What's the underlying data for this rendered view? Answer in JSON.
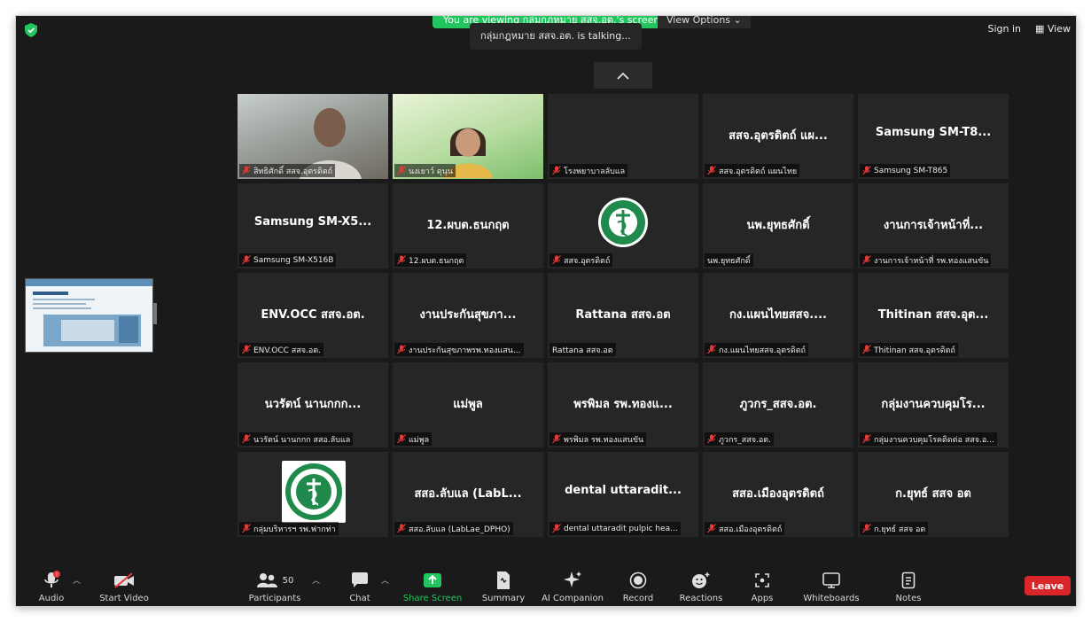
{
  "banner": {
    "viewing_text": "You are viewing กลุ่มกฎหมาย สสจ.อต.'s screen",
    "view_options": "View Options",
    "talking_text": "กลุ่มกฎหมาย สสจ.อต. is talking..."
  },
  "topright": {
    "sign_in": "Sign in",
    "view": "View"
  },
  "tiles": [
    {
      "big": "",
      "label": "สิทธิศักดิ์ สสจ.อุตรดิตถ์",
      "muted": true,
      "kind": "video1"
    },
    {
      "big": "",
      "label": "นงเยาว์ ดุนุน",
      "muted": true,
      "kind": "video2"
    },
    {
      "big": "",
      "label": "โรงพยาบาลลับแล",
      "muted": true,
      "kind": "blank"
    },
    {
      "big": "สสจ.อุตรดิตถ์ แผ...",
      "label": "สสจ.อุตรดิตถ์ แผนไทย",
      "muted": true,
      "kind": "name"
    },
    {
      "big": "Samsung  SM-T8...",
      "label": "Samsung SM-T865",
      "muted": true,
      "kind": "name"
    },
    {
      "big": "Samsung  SM-X5...",
      "label": "Samsung SM-X516B",
      "muted": true,
      "kind": "name"
    },
    {
      "big": "12.ผบต.ธนกฤต",
      "label": "12.ผบต.ธนกฤต",
      "muted": true,
      "kind": "name"
    },
    {
      "big": "",
      "label": "สสจ.อุตรดิตถ์",
      "muted": true,
      "kind": "doh"
    },
    {
      "big": "นพ.ยุทธศักดิ์",
      "label": "นพ.ยุทธศักดิ์",
      "muted": false,
      "kind": "name"
    },
    {
      "big": "งานการเจ้าหน้าที่...",
      "label": "งานการเจ้าหน้าที่ รพ.ทองแสนขัน",
      "muted": true,
      "kind": "name"
    },
    {
      "big": "ENV.OCC สสจ.อต.",
      "label": "ENV.OCC สสจ.อต.",
      "muted": true,
      "kind": "name"
    },
    {
      "big": "งานประกันสุขภา...",
      "label": "งานประกันสุขภาพรพ.ทองแสน...",
      "muted": true,
      "kind": "name"
    },
    {
      "big": "Rattana สสจ.อต",
      "label": "Rattana สสจ.อต",
      "muted": false,
      "kind": "name"
    },
    {
      "big": "กง.แผนไทยสสจ....",
      "label": "กง.แผนไทยสสจ.อุตรดิตถ์",
      "muted": true,
      "kind": "name"
    },
    {
      "big": "Thitinan สสจ.อุต...",
      "label": "Thitinan สสจ.อุตรดิตถ์",
      "muted": true,
      "kind": "name"
    },
    {
      "big": "นวรัตน์ นานกกก...",
      "label": "นวรัตน์ นานกกก สสอ.ลับแล",
      "muted": true,
      "kind": "name"
    },
    {
      "big": "แม่พูล",
      "label": "แม่พูล",
      "muted": true,
      "kind": "name"
    },
    {
      "big": "พรพิมล รพ.ทองแ...",
      "label": "พรพิมล รพ.ทองแสนขัน",
      "muted": true,
      "kind": "name"
    },
    {
      "big": "ภูวกร_สสจ.อต.",
      "label": "ภูวกร_สสจ.อต.",
      "muted": true,
      "kind": "name"
    },
    {
      "big": "กลุ่มงานควบคุมโร...",
      "label": "กลุ่มงานควบคุมโรคติดต่อ สสจ.อ...",
      "muted": true,
      "kind": "name"
    },
    {
      "big": "",
      "label": "กลุ่มบริหารฯ รพ.ฟากท่า",
      "muted": true,
      "kind": "hospital"
    },
    {
      "big": "สสอ.ลับแล (LabL...",
      "label": "สสอ.ลับแล (LabLae_DPHO)",
      "muted": true,
      "kind": "name"
    },
    {
      "big": "dental  uttaradit...",
      "label": "dental  uttaradit pulpic hea...",
      "muted": true,
      "kind": "name"
    },
    {
      "big": "สสอ.เมืองอุตรดิตถ์",
      "label": "สสอ.เมืองอุตรดิตถ์",
      "muted": true,
      "kind": "name"
    },
    {
      "big": "ก.ยุทธ์ สสจ อต",
      "label": "ก.ยุทธ์ สสจ อต",
      "muted": true,
      "kind": "name"
    }
  ],
  "toolbar": {
    "audio": "Audio",
    "start_video": "Start Video",
    "participants": "Participants",
    "participant_count": "50",
    "chat": "Chat",
    "share_screen": "Share Screen",
    "summary": "Summary",
    "ai_companion": "AI Companion",
    "record": "Record",
    "reactions": "Reactions",
    "apps": "Apps",
    "whiteboards": "Whiteboards",
    "notes": "Notes",
    "leave": "Leave"
  },
  "colors": {
    "share_green": "#22c55e",
    "leave_red": "#d9262b",
    "mute_red": "#e53935"
  }
}
